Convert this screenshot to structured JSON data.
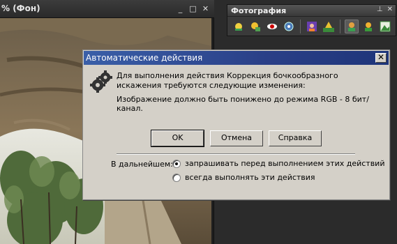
{
  "document_window": {
    "title": "% (Фон)",
    "controls": {
      "minimize": "_",
      "maximize": "□",
      "close": "✕"
    }
  },
  "photo_panel": {
    "title": "Фотография",
    "controls": {
      "pin": "⊥",
      "close": "✕"
    },
    "icons": [
      "auto-levels-icon",
      "auto-contrast-icon",
      "red-eye-icon",
      "lens-distortion-icon",
      "portrait-icon",
      "tree-landscape-icon",
      "person-green-icon",
      "person-orange-icon",
      "landscape-icon"
    ]
  },
  "dialog": {
    "title": "Автоматические действия",
    "close_label": "✕",
    "message_line": "Для выполнения действия Коррекция бочкообразного искажения требуются следующие изменения:",
    "change_line": "Изображение должно быть понижено до режима RGB - 8 бит/канал.",
    "buttons": {
      "ok": "OK",
      "cancel": "Отмена",
      "help": "Справка"
    },
    "future_label": "В дальнейшем:",
    "options": [
      {
        "label": "запрашивать перед выполнением этих действий",
        "selected": true
      },
      {
        "label": "всегда выполнять эти действия",
        "selected": false
      }
    ]
  }
}
